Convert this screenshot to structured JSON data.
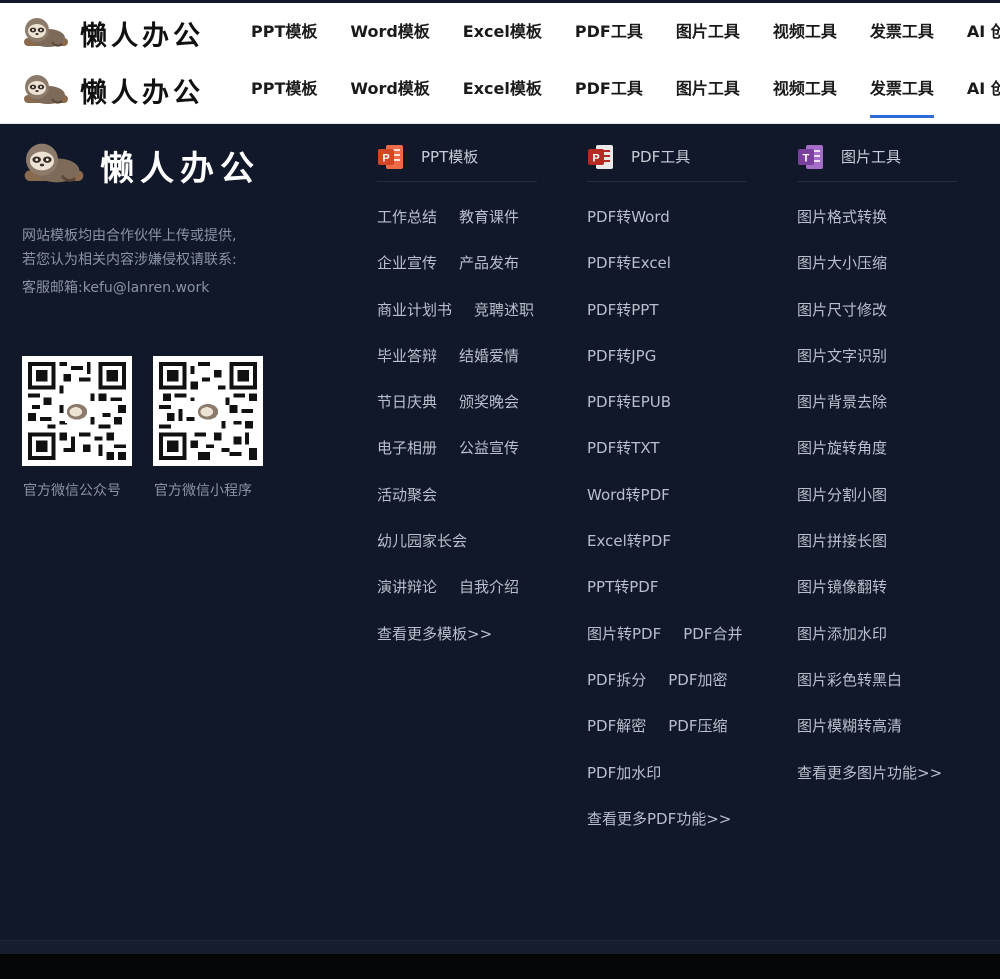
{
  "brand": {
    "name": "懒人办公"
  },
  "nav": {
    "items": [
      "PPT模板",
      "Word模板",
      "Excel模板",
      "PDF工具",
      "图片工具",
      "视频工具",
      "发票工具",
      "AI 创作"
    ],
    "active_index_second_bar": 6
  },
  "footer": {
    "desc_line1": "网站模板均由合作伙伴上传或提供,",
    "desc_line2": "若您认为相关内容涉嫌侵权请联系:",
    "email": "客服邮箱:kefu@lanren.work",
    "qr": [
      {
        "label": "官方微信公众号"
      },
      {
        "label": "官方微信小程序"
      }
    ],
    "columns": [
      {
        "title": "PPT模板",
        "icon": "powerpoint-icon",
        "rows": [
          [
            "工作总结",
            "教育课件"
          ],
          [
            "企业宣传",
            "产品发布"
          ],
          [
            "商业计划书",
            "竞聘述职"
          ],
          [
            "毕业答辩",
            "结婚爱情"
          ],
          [
            "节日庆典",
            "颁奖晚会"
          ],
          [
            "电子相册",
            "公益宣传"
          ],
          [
            "活动聚会"
          ],
          [
            "幼儿园家长会"
          ],
          [
            "演讲辩论",
            "自我介绍"
          ],
          [
            "查看更多模板>>"
          ]
        ]
      },
      {
        "title": "PDF工具",
        "icon": "pdf-icon",
        "rows": [
          [
            "PDF转Word"
          ],
          [
            "PDF转Excel"
          ],
          [
            "PDF转PPT"
          ],
          [
            "PDF转JPG"
          ],
          [
            "PDF转EPUB"
          ],
          [
            "PDF转TXT"
          ],
          [
            "Word转PDF"
          ],
          [
            "Excel转PDF"
          ],
          [
            "PPT转PDF"
          ],
          [
            "图片转PDF",
            "PDF合并"
          ],
          [
            "PDF拆分",
            "PDF加密"
          ],
          [
            "PDF解密",
            "PDF压缩"
          ],
          [
            "PDF加水印"
          ],
          [
            "查看更多PDF功能>>"
          ]
        ]
      },
      {
        "title": "图片工具",
        "icon": "onenote-icon",
        "rows": [
          [
            "图片格式转换"
          ],
          [
            "图片大小压缩"
          ],
          [
            "图片尺寸修改"
          ],
          [
            "图片文字识别"
          ],
          [
            "图片背景去除"
          ],
          [
            "图片旋转角度"
          ],
          [
            "图片分割小图"
          ],
          [
            "图片拼接长图"
          ],
          [
            "图片镜像翻转"
          ],
          [
            "图片添加水印"
          ],
          [
            "图片彩色转黑白"
          ],
          [
            "图片模糊转高清"
          ],
          [
            "查看更多图片功能>>"
          ]
        ]
      }
    ]
  },
  "colors": {
    "footer_bg": "#111829",
    "accent": "#2f6bd8",
    "ppt_orange": "#d24625",
    "pdf_red": "#b52b22",
    "onenote_purple": "#7b3f9e"
  }
}
